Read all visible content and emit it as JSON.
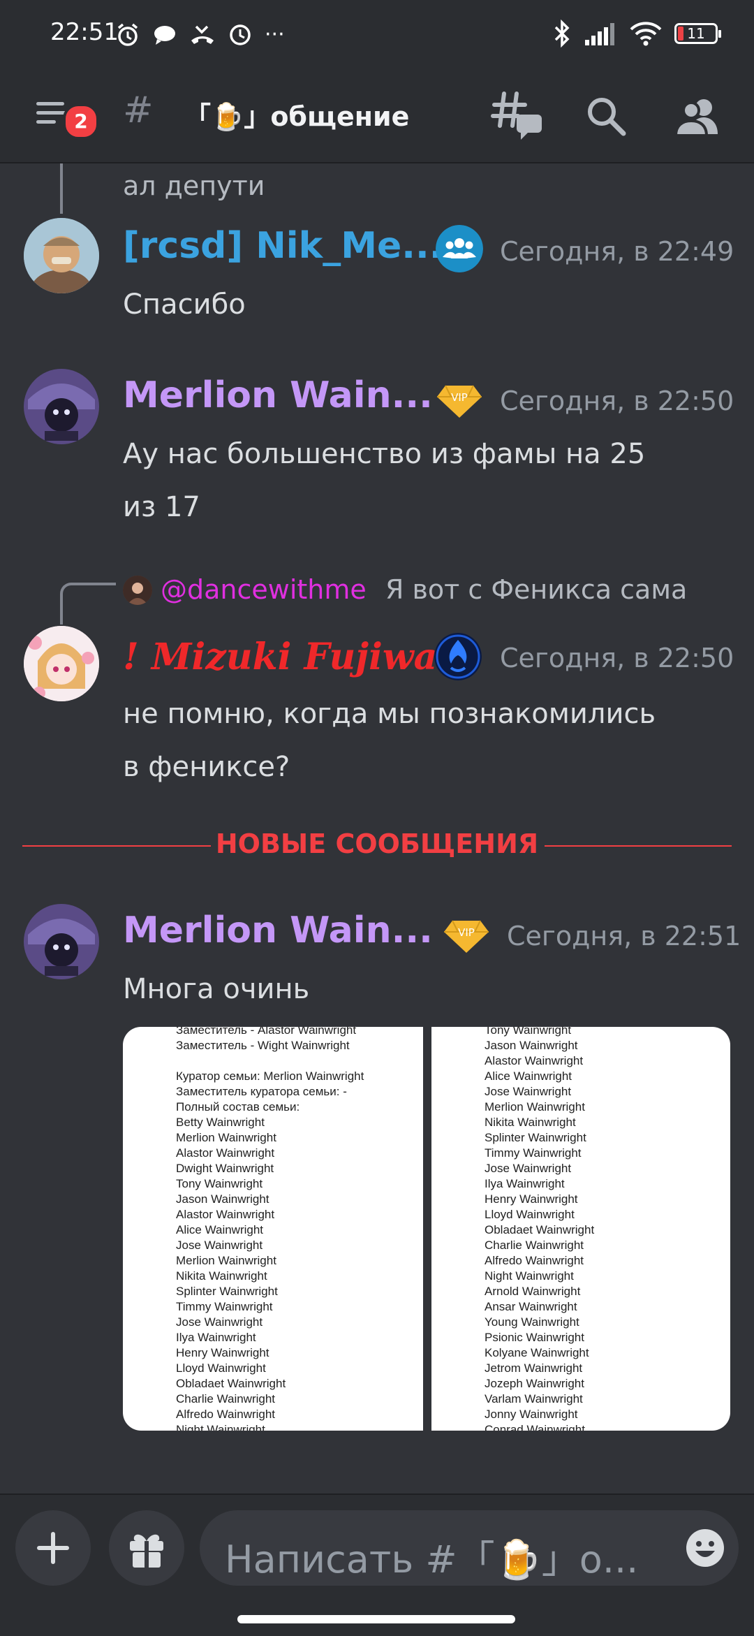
{
  "status_bar": {
    "time": "22:51",
    "battery": "11"
  },
  "header": {
    "notification_count": "2",
    "channel_name": "「🍺」общение"
  },
  "messages": [
    {
      "continuation_text": "ал депути"
    },
    {
      "author": "[rcsd] Nik_Me...",
      "author_color": "#3ba3e0",
      "timestamp": "Сегодня, в 22:49",
      "lines": [
        "Спасибо"
      ]
    },
    {
      "author": "Merlion Wain...",
      "author_color": "#c497f7",
      "timestamp": "Сегодня, в 22:50",
      "lines": [
        "Ау нас большенство из фамы на 25",
        "из 17"
      ]
    },
    {
      "reply_mention": "@dancewithme",
      "reply_text": "Я вот с Феникса сама",
      "author": "! Mizuki Fujiwa...",
      "author_color": "#f0282a",
      "timestamp": "Сегодня, в 22:50",
      "lines": [
        "не помню, когда мы познакомились",
        "в фениксе?"
      ]
    },
    {
      "author": "Merlion Wain...",
      "author_color": "#c497f7",
      "timestamp": "Сегодня, в 22:51",
      "lines": [
        "Многа очинь"
      ]
    }
  ],
  "new_messages_label": "НОВЫЕ СООБЩЕНИЯ",
  "attachments": [
    {
      "text": "Заместитель - Alastor Wainwright\nЗаместитель - Wight Wainwright\n\nКуратор семьи: Merlion Wainwright\nЗаместитель куратора семьи: -\nПолный состав семьи:\nBetty Wainwright\nMerlion Wainwright\nAlastor Wainwright\nDwight Wainwright\nTony Wainwright\nJason Wainwright\nAlastor Wainwright\nAlice Wainwright\nJose Wainwright\nMerlion Wainwright\nNikita Wainwright\nSplinter Wainwright\nTimmy Wainwright\nJose Wainwright\nIlya Wainwright\nHenry Wainwright\nLloyd Wainwright\nObladaet Wainwright\nCharlie Wainwright\nAlfredo Wainwright\nNight Wainwright"
    },
    {
      "text": "Tony Wainwright\nJason Wainwright\nAlastor Wainwright\nAlice Wainwright\nJose Wainwright\nMerlion Wainwright\nNikita Wainwright\nSplinter Wainwright\nTimmy Wainwright\nJose Wainwright\nIlya Wainwright\nHenry Wainwright\nLloyd Wainwright\nObladaet Wainwright\nCharlie Wainwright\nAlfredo Wainwright\nNight Wainwright\nArnold Wainwright\nAnsar Wainwright\nYoung Wainwright\nPsionic Wainwright\nKolyane Wainwright\nJetrom Wainwright\nJozeph Wainwright\nVarlam Wainwright\nJonny Wainwright\nConrad Wainwright"
    }
  ],
  "composer": {
    "placeholder": "Написать #「🍺」о..."
  },
  "icons": {
    "menu": "hamburger-icon",
    "hash": "hash-icon",
    "threads": "threads-icon",
    "search": "search-icon",
    "members": "members-icon",
    "add": "plus-icon",
    "gift": "gift-icon",
    "emoji": "emoji-icon"
  },
  "colors": {
    "background": "#313338",
    "header": "#2b2d31",
    "new_divider": "#f23f43",
    "badge": "#f23f43"
  }
}
